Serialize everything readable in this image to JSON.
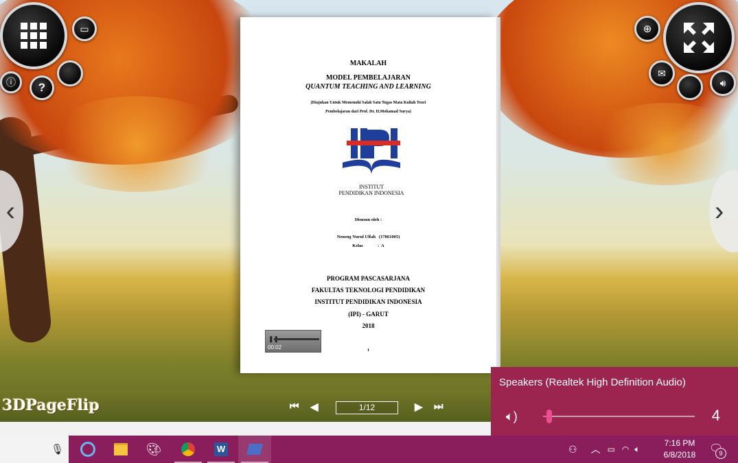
{
  "viewer": {
    "brand": "3DPageFlip",
    "page_indicator": "1/12",
    "audio_time": "00:02"
  },
  "document_page": {
    "heading": "MAKALAH",
    "title_line1": "MODEL PEMBELAJARAN",
    "title_line2": "QUANTUM TEACHING AND LEARNING",
    "purpose_line1": "(Diajukan Untuk Memenuhi Salah Satu Tugas Mata Kuliah Teori",
    "purpose_line2": "Pembelajaran dari Prof. Dr. H.Mohamad Surya)",
    "logo_text": "IPI",
    "logo_caption1": "INSTITUT",
    "logo_caption2": "PENDIDIKAN INDONESIA",
    "authored_by": "Disusun oleh :",
    "author_line": "Neneng Nurul Ulfah   (17861005)",
    "class_line": "Kelas             :  A",
    "footer_line1": "PROGRAM PASCASARJANA",
    "footer_line2": "FAKULTAS TEKNOLOGI PENDIDIKAN",
    "footer_line3": "INSTITUT PENDIDIKAN INDONESIA",
    "footer_line4": "(IPI) - GARUT",
    "footer_line5": "2018",
    "page_number": "1"
  },
  "volume_flyout": {
    "device": "Speakers (Realtek High Definition Audio)",
    "level": "4",
    "level_fraction": 0.04
  },
  "tray": {
    "time": "7:16 PM",
    "date": "6/8/2018",
    "notification_count": "9"
  },
  "colors": {
    "taskbar": "#8a1e5c",
    "flyout": "#9c254f",
    "slider_accent": "#ec4f8f"
  }
}
